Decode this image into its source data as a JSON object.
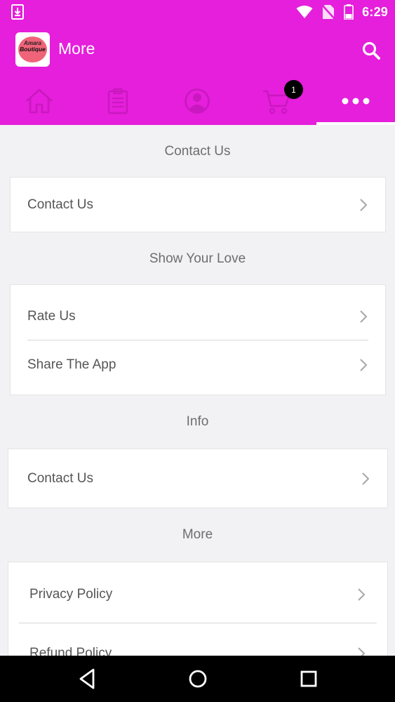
{
  "status_bar": {
    "time": "6:29",
    "icons": [
      "download-icon",
      "wifi-icon",
      "no-sim-icon",
      "battery-icon"
    ]
  },
  "app_bar": {
    "logo_line1": "Amara",
    "logo_line2": "Boutique",
    "title": "More",
    "search_icon": "search-icon"
  },
  "tabs": [
    {
      "icon": "home-icon"
    },
    {
      "icon": "clipboard-icon"
    },
    {
      "icon": "account-icon"
    },
    {
      "icon": "cart-icon",
      "badge": "1"
    },
    {
      "icon": "more-dots-icon",
      "selected": true
    }
  ],
  "sections": {
    "contact": {
      "title": "Contact Us",
      "items": [
        {
          "label": "Contact Us"
        }
      ]
    },
    "love": {
      "title": "Show Your Love",
      "items": [
        {
          "label": "Rate Us"
        },
        {
          "label": "Share The App"
        }
      ]
    },
    "info": {
      "title": "Info",
      "items": [
        {
          "label": "Contact Us"
        }
      ]
    },
    "more": {
      "title": "More",
      "items": [
        {
          "label": "Privacy Policy"
        },
        {
          "label": "Refund Policy"
        }
      ]
    }
  },
  "colors": {
    "brand": "#e51fdb",
    "background": "#f2f1f4",
    "tab_icon": "#c918bf",
    "badge": "#000000"
  },
  "nav_bar": {
    "icons": [
      "back-icon",
      "home-circle-icon",
      "recents-icon"
    ]
  }
}
